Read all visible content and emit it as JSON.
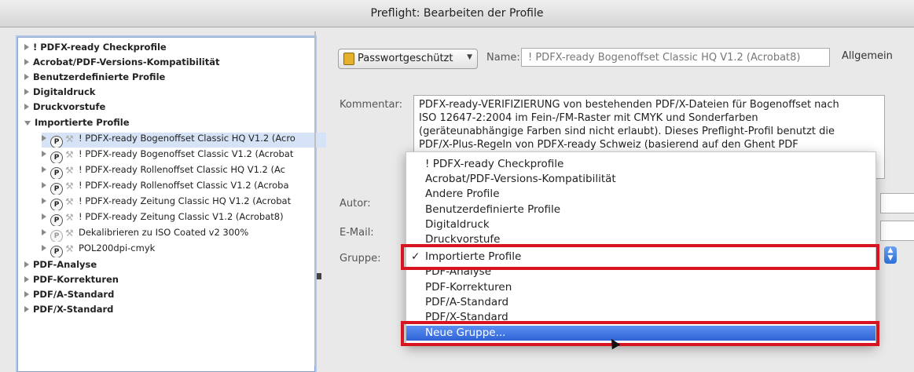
{
  "window": {
    "title": "Preflight: Bearbeiten der Profile"
  },
  "tree": {
    "categories_top": [
      "! PDFX-ready Checkprofile",
      "Acrobat/PDF-Versions-Kompatibilität",
      "Benutzerdefinierte Profile",
      "Digitaldruck",
      "Druckvorstufe"
    ],
    "expanded_category": "Importierte Profile",
    "profiles": [
      "! PDFX-ready Bogenoffset Classic HQ V1.2 (Acro",
      "! PDFX-ready Bogenoffset Classic V1.2 (Acrobat",
      "! PDFX-ready Rollenoffset Classic HQ V1.2 (Ac",
      "! PDFX-ready Rollenoffset Classic V1.2 (Acroba",
      "! PDFX-ready Zeitung Classic HQ V1.2 (Acrobat",
      "! PDFX-ready Zeitung Classic V1.2 (Acrobat8)",
      "Dekalibrieren zu ISO Coated v2 300%",
      "POL200dpi-cmyk"
    ],
    "categories_bottom": [
      "PDF-Analyse",
      "PDF-Korrekturen",
      "PDF/A-Standard",
      "PDF/X-Standard"
    ]
  },
  "details": {
    "password_button": "Passwortgeschützt",
    "name_label": "Name:",
    "name_value": "! PDFX-ready Bogenoffset Classic HQ V1.2 (Acrobat8)",
    "general_label": "Allgemein",
    "comment_label": "Kommentar:",
    "comment_lines": [
      "PDFX-ready-VERIFIZIERUNG von bestehenden PDF/X-Dateien für Bogenoffset nach",
      "ISO 12647-2:2004 im Fein-/FM-Raster mit CMYK und Sonderfarben",
      "(geräteunabhängige Farben sind nicht erlaubt). Dieses Preflight-Profil benutzt die",
      "PDF/X-Plus-Regeln von PDFX-ready Schweiz (basierend auf den Ghent PDF"
    ],
    "author_label": "Autor:",
    "email_label": "E-Mail:",
    "group_label": "Gruppe:"
  },
  "group_menu": {
    "items_before": [
      "! PDFX-ready Checkprofile",
      "Acrobat/PDF-Versions-Kompatibilität",
      "Andere Profile",
      "Benutzerdefinierte Profile",
      "Digitaldruck",
      "Druckvorstufe"
    ],
    "checked_item": "Importierte Profile",
    "checkmark": "✓",
    "items_after": [
      "PDF-Analyse",
      "PDF-Korrekturen",
      "PDF/A-Standard",
      "PDF/X-Standard"
    ],
    "highlighted_item": "Neue Gruppe..."
  },
  "colors": {
    "highlight": "#2f63d6",
    "annotation_red": "#d81420"
  }
}
